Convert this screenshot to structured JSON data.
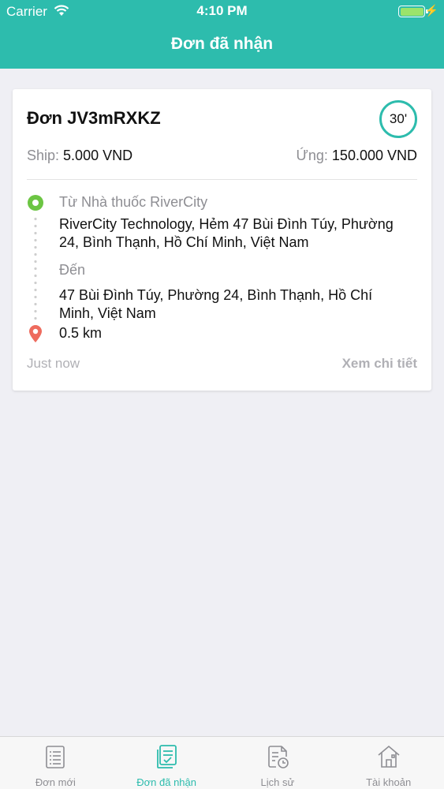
{
  "status_bar": {
    "carrier": "Carrier",
    "time": "4:10 PM"
  },
  "header": {
    "title": "Đơn đã nhận"
  },
  "order": {
    "code": "Đơn JV3mRXKZ",
    "timer": "30'",
    "ship_label": "Ship:",
    "ship_value": "5.000 VND",
    "advance_label": "Ứng:",
    "advance_value": "150.000 VND",
    "from_label": "Từ Nhà thuốc RiverCity",
    "from_address": "RiverCity Technology, Hẻm 47 Bùi Đình Túy, Phường 24, Bình Thạnh, Hồ Chí Minh, Việt Nam",
    "to_label": "Đến",
    "to_address": "47 Bùi Đình Túy, Phường 24, Bình Thạnh, Hồ Chí Minh, Việt Nam",
    "distance": "0.5 km",
    "time_ago": "Just now",
    "detail_link": "Xem chi tiết"
  },
  "tabs": [
    {
      "label": "Đơn mới",
      "icon": "document-list-icon",
      "active": false
    },
    {
      "label": "Đơn đã nhận",
      "icon": "document-check-icon",
      "active": true
    },
    {
      "label": "Lịch sử",
      "icon": "history-icon",
      "active": false
    },
    {
      "label": "Tài khoản",
      "icon": "home-account-icon",
      "active": false
    }
  ],
  "colors": {
    "primary": "#2dbcad",
    "start_marker": "#6cc543",
    "end_marker": "#ee6b5e"
  }
}
